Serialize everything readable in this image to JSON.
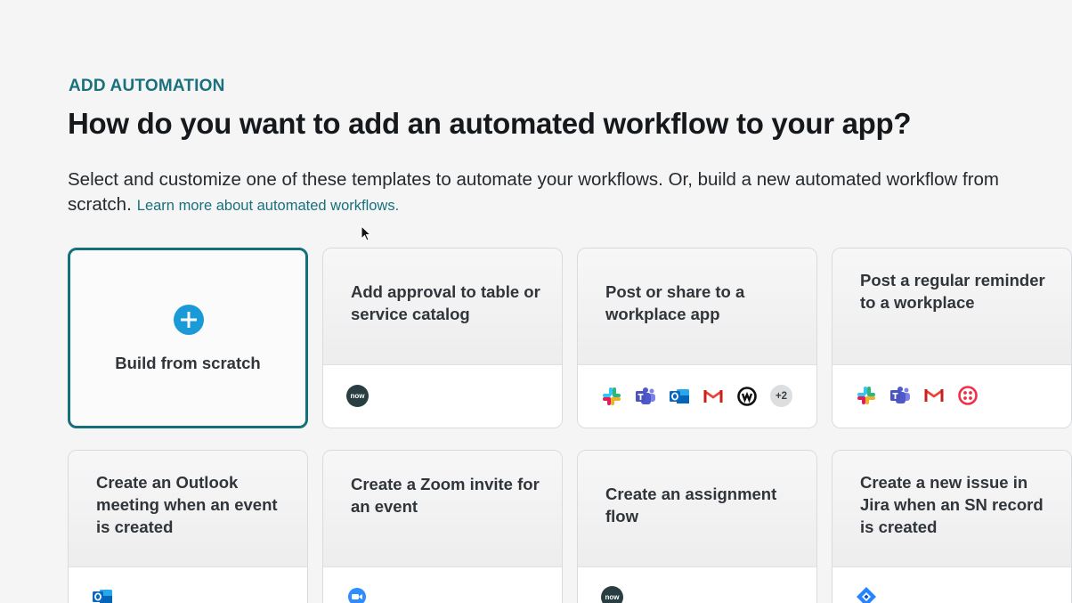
{
  "header": {
    "eyebrow": "ADD AUTOMATION",
    "title": "How do you want to add an automated workflow to your app?",
    "description": "Select and customize one of these templates to automate your workflows. Or, build a new automated workflow from scratch.",
    "learn_more_link": "Learn more about automated workflows."
  },
  "colors": {
    "accent": "#16707b",
    "plus_blue": "#1a9ad6",
    "background": "#f5f5f6"
  },
  "scratch_card": {
    "label": "Build from scratch",
    "icon": "plus-circle-icon"
  },
  "templates": [
    {
      "title": "Add approval to table or service catalog",
      "icons": [
        "servicenow-icon"
      ]
    },
    {
      "title": "Post or share to a workplace app",
      "icons": [
        "slack-icon",
        "teams-icon",
        "outlook-icon",
        "gmail-icon",
        "workplace-icon"
      ],
      "more_count": "+2"
    },
    {
      "title": "Post a regular reminder to a workplace",
      "icons": [
        "slack-icon",
        "teams-icon",
        "gmail-icon",
        "twilio-icon"
      ]
    },
    {
      "title": "Create an Outlook meeting when an event is created",
      "icons": [
        "outlook-icon"
      ]
    },
    {
      "title": "Create a Zoom invite for an event",
      "icons": [
        "zoom-icon"
      ]
    },
    {
      "title": "Create an assignment flow",
      "icons": [
        "servicenow-icon"
      ]
    },
    {
      "title": "Create a new issue in Jira when an SN record is created",
      "icons": [
        "jira-icon"
      ]
    }
  ],
  "servicenow_badge_text": "now"
}
